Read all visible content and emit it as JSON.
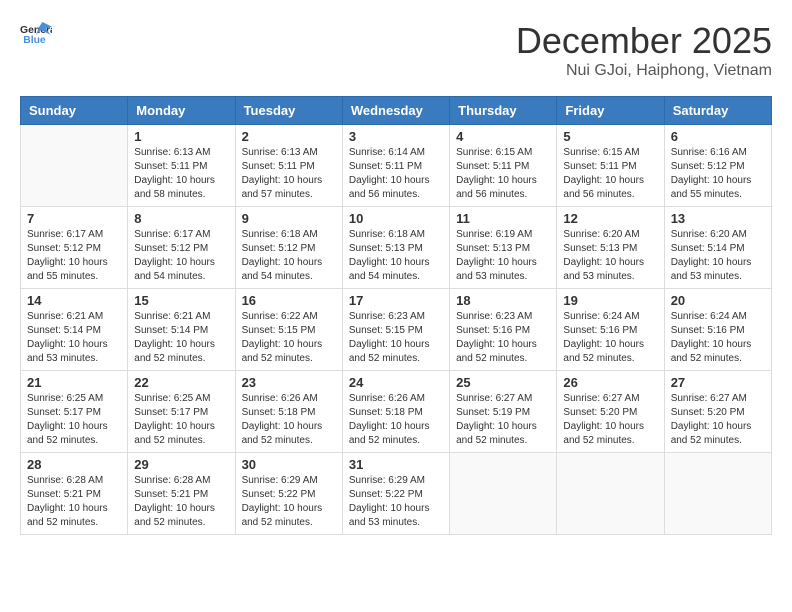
{
  "header": {
    "logo_line1": "General",
    "logo_line2": "Blue",
    "month_title": "December 2025",
    "location": "Nui GJoi, Haiphong, Vietnam"
  },
  "days_of_week": [
    "Sunday",
    "Monday",
    "Tuesday",
    "Wednesday",
    "Thursday",
    "Friday",
    "Saturday"
  ],
  "weeks": [
    [
      {
        "day": "",
        "info": ""
      },
      {
        "day": "1",
        "info": "Sunrise: 6:13 AM\nSunset: 5:11 PM\nDaylight: 10 hours\nand 58 minutes."
      },
      {
        "day": "2",
        "info": "Sunrise: 6:13 AM\nSunset: 5:11 PM\nDaylight: 10 hours\nand 57 minutes."
      },
      {
        "day": "3",
        "info": "Sunrise: 6:14 AM\nSunset: 5:11 PM\nDaylight: 10 hours\nand 56 minutes."
      },
      {
        "day": "4",
        "info": "Sunrise: 6:15 AM\nSunset: 5:11 PM\nDaylight: 10 hours\nand 56 minutes."
      },
      {
        "day": "5",
        "info": "Sunrise: 6:15 AM\nSunset: 5:11 PM\nDaylight: 10 hours\nand 56 minutes."
      },
      {
        "day": "6",
        "info": "Sunrise: 6:16 AM\nSunset: 5:12 PM\nDaylight: 10 hours\nand 55 minutes."
      }
    ],
    [
      {
        "day": "7",
        "info": "Sunrise: 6:17 AM\nSunset: 5:12 PM\nDaylight: 10 hours\nand 55 minutes."
      },
      {
        "day": "8",
        "info": "Sunrise: 6:17 AM\nSunset: 5:12 PM\nDaylight: 10 hours\nand 54 minutes."
      },
      {
        "day": "9",
        "info": "Sunrise: 6:18 AM\nSunset: 5:12 PM\nDaylight: 10 hours\nand 54 minutes."
      },
      {
        "day": "10",
        "info": "Sunrise: 6:18 AM\nSunset: 5:13 PM\nDaylight: 10 hours\nand 54 minutes."
      },
      {
        "day": "11",
        "info": "Sunrise: 6:19 AM\nSunset: 5:13 PM\nDaylight: 10 hours\nand 53 minutes."
      },
      {
        "day": "12",
        "info": "Sunrise: 6:20 AM\nSunset: 5:13 PM\nDaylight: 10 hours\nand 53 minutes."
      },
      {
        "day": "13",
        "info": "Sunrise: 6:20 AM\nSunset: 5:14 PM\nDaylight: 10 hours\nand 53 minutes."
      }
    ],
    [
      {
        "day": "14",
        "info": "Sunrise: 6:21 AM\nSunset: 5:14 PM\nDaylight: 10 hours\nand 53 minutes."
      },
      {
        "day": "15",
        "info": "Sunrise: 6:21 AM\nSunset: 5:14 PM\nDaylight: 10 hours\nand 52 minutes."
      },
      {
        "day": "16",
        "info": "Sunrise: 6:22 AM\nSunset: 5:15 PM\nDaylight: 10 hours\nand 52 minutes."
      },
      {
        "day": "17",
        "info": "Sunrise: 6:23 AM\nSunset: 5:15 PM\nDaylight: 10 hours\nand 52 minutes."
      },
      {
        "day": "18",
        "info": "Sunrise: 6:23 AM\nSunset: 5:16 PM\nDaylight: 10 hours\nand 52 minutes."
      },
      {
        "day": "19",
        "info": "Sunrise: 6:24 AM\nSunset: 5:16 PM\nDaylight: 10 hours\nand 52 minutes."
      },
      {
        "day": "20",
        "info": "Sunrise: 6:24 AM\nSunset: 5:16 PM\nDaylight: 10 hours\nand 52 minutes."
      }
    ],
    [
      {
        "day": "21",
        "info": "Sunrise: 6:25 AM\nSunset: 5:17 PM\nDaylight: 10 hours\nand 52 minutes."
      },
      {
        "day": "22",
        "info": "Sunrise: 6:25 AM\nSunset: 5:17 PM\nDaylight: 10 hours\nand 52 minutes."
      },
      {
        "day": "23",
        "info": "Sunrise: 6:26 AM\nSunset: 5:18 PM\nDaylight: 10 hours\nand 52 minutes."
      },
      {
        "day": "24",
        "info": "Sunrise: 6:26 AM\nSunset: 5:18 PM\nDaylight: 10 hours\nand 52 minutes."
      },
      {
        "day": "25",
        "info": "Sunrise: 6:27 AM\nSunset: 5:19 PM\nDaylight: 10 hours\nand 52 minutes."
      },
      {
        "day": "26",
        "info": "Sunrise: 6:27 AM\nSunset: 5:20 PM\nDaylight: 10 hours\nand 52 minutes."
      },
      {
        "day": "27",
        "info": "Sunrise: 6:27 AM\nSunset: 5:20 PM\nDaylight: 10 hours\nand 52 minutes."
      }
    ],
    [
      {
        "day": "28",
        "info": "Sunrise: 6:28 AM\nSunset: 5:21 PM\nDaylight: 10 hours\nand 52 minutes."
      },
      {
        "day": "29",
        "info": "Sunrise: 6:28 AM\nSunset: 5:21 PM\nDaylight: 10 hours\nand 52 minutes."
      },
      {
        "day": "30",
        "info": "Sunrise: 6:29 AM\nSunset: 5:22 PM\nDaylight: 10 hours\nand 52 minutes."
      },
      {
        "day": "31",
        "info": "Sunrise: 6:29 AM\nSunset: 5:22 PM\nDaylight: 10 hours\nand 53 minutes."
      },
      {
        "day": "",
        "info": ""
      },
      {
        "day": "",
        "info": ""
      },
      {
        "day": "",
        "info": ""
      }
    ]
  ]
}
